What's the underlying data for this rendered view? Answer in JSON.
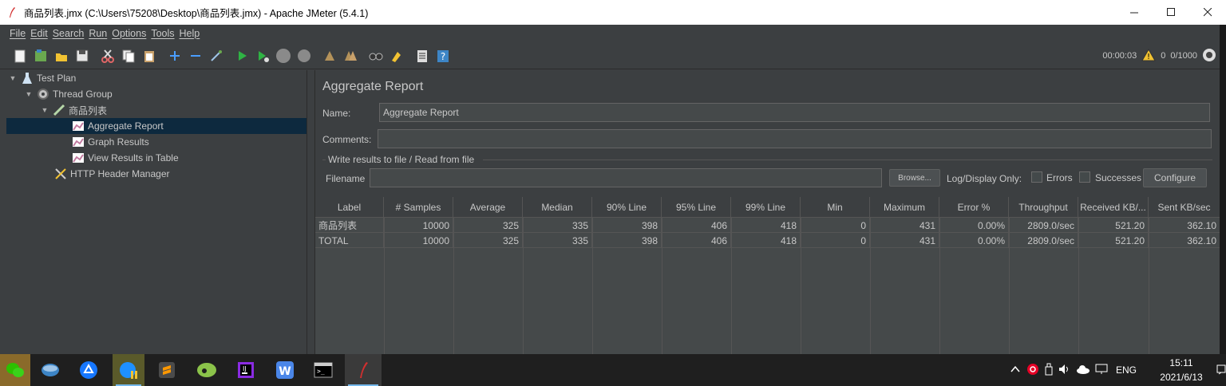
{
  "window": {
    "title": "商品列表.jmx (C:\\Users\\75208\\Desktop\\商品列表.jmx) - Apache JMeter (5.4.1)",
    "minimize": "—",
    "maximize": "☐",
    "close": "✕"
  },
  "menu": [
    "File",
    "Edit",
    "Search",
    "Run",
    "Options",
    "Tools",
    "Help"
  ],
  "toolbar_status": {
    "elapsed": "00:00:03",
    "warnings": "0",
    "threads": "0/1000"
  },
  "tree": [
    {
      "label": "Test Plan",
      "icon": "test-plan-icon"
    },
    {
      "label": "Thread Group",
      "icon": "thread-group-icon"
    },
    {
      "label": "商品列表",
      "icon": "http-sampler-icon"
    },
    {
      "label": "Aggregate Report",
      "icon": "listener-icon"
    },
    {
      "label": "Graph Results",
      "icon": "listener-icon"
    },
    {
      "label": "View Results in Table",
      "icon": "listener-icon"
    },
    {
      "label": "HTTP Header Manager",
      "icon": "config-element-icon"
    }
  ],
  "panel": {
    "title": "Aggregate Report",
    "name_label": "Name:",
    "name_value": "Aggregate Report",
    "comments_label": "Comments:",
    "comments_value": "",
    "file_group_title": "Write results to file / Read from file",
    "filename_label": "Filename",
    "filename_value": "",
    "browse_label": "Browse...",
    "log_display_label": "Log/Display Only:",
    "errors_label": "Errors",
    "successes_label": "Successes",
    "configure_label": "Configure"
  },
  "table": {
    "columns": [
      "Label",
      "# Samples",
      "Average",
      "Median",
      "90% Line",
      "95% Line",
      "99% Line",
      "Min",
      "Maximum",
      "Error %",
      "Throughput",
      "Received KB/...",
      "Sent KB/sec"
    ],
    "rows": [
      [
        "商品列表",
        "10000",
        "325",
        "335",
        "398",
        "406",
        "418",
        "0",
        "431",
        "0.00%",
        "2809.0/sec",
        "521.20",
        "362.10"
      ],
      [
        "TOTAL",
        "10000",
        "325",
        "335",
        "398",
        "406",
        "418",
        "0",
        "431",
        "0.00%",
        "2809.0/sec",
        "521.20",
        "362.10"
      ]
    ]
  },
  "taskbar": {
    "language": "ENG",
    "time": "15:11",
    "date": "2021/6/13"
  }
}
